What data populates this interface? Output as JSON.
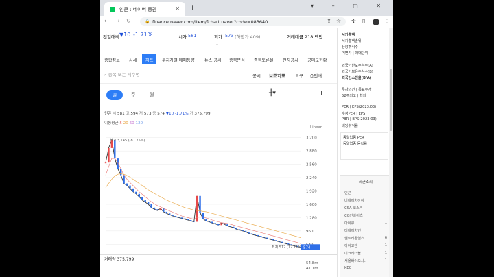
{
  "browser": {
    "tab_title": "인콘 : 네이버 증권",
    "url": "finance.naver.com/item/fchart.naver?code=083640"
  },
  "ticker": {
    "prev_label": "전일대비",
    "change": "▼10",
    "change_pct": "-1.71%",
    "open_label": "시가",
    "open": "581",
    "low_label": "저가",
    "low": "573",
    "low_limit": "(하한가 409)",
    "value_label": "거래대금",
    "value": "218 백만"
  },
  "tabs": [
    "종합정보",
    "시세",
    "차트",
    "투자자별 매매동향",
    "뉴스 공시",
    "종목분석",
    "종목토론실",
    "전자공시",
    "공매도현황"
  ],
  "active_tab": "차트",
  "search": {
    "placeholder": "종목 또는 지수명"
  },
  "tools": {
    "notice": "공시",
    "indicators": "보조지표",
    "tools": "도구",
    "print": "인쇄"
  },
  "periods": [
    "일",
    "주",
    "월"
  ],
  "ohlc": {
    "name": "인콘",
    "open_label": "시",
    "open": "581",
    "high_label": "고",
    "high": "594",
    "low_label": "저",
    "low": "573",
    "close_label": "종",
    "close": "574",
    "change": "▼10 -1.71%",
    "vol_label": "거",
    "volume": "375,799"
  },
  "ma": {
    "label": "이동평균",
    "values": [
      "5",
      "20",
      "60",
      "120"
    ]
  },
  "chart_data": {
    "type": "line",
    "scale": "Linear",
    "y_ticks": [
      "3,200",
      "2,880",
      "2,560",
      "2,240",
      "1,920",
      "1,600",
      "1,280",
      "960",
      "640"
    ],
    "ylim": [
      480,
      3360
    ],
    "max_label": "최고 3,145 (-81.75%)",
    "min_label": "최저 512 (12.11%)",
    "last_price": "574",
    "series": [
      {
        "values": [
          2600,
          2950,
          3145,
          2700,
          2450,
          2300,
          2100,
          2050,
          1980,
          1900,
          1850,
          1780,
          1700,
          1650,
          1600,
          1520,
          1480,
          1450,
          1500,
          1420,
          1380,
          1350,
          1320,
          1300,
          1280,
          1260,
          1240,
          1220,
          1200,
          1180,
          1800,
          1400,
          1250,
          1200,
          1180,
          1150,
          1130,
          1100,
          1150,
          1120,
          1080,
          1060,
          1040,
          1000,
          980,
          960,
          940,
          900,
          880,
          860,
          840,
          820,
          800,
          780,
          760,
          740,
          720,
          700,
          680,
          660,
          640,
          620,
          600,
          580,
          574
        ]
      },
      {
        "values": [
          2300,
          2500,
          2700,
          2700,
          2600,
          2450,
          2300,
          2200,
          2120,
          2050,
          1980,
          1900,
          1840,
          1780,
          1720,
          1660,
          1610,
          1570,
          1540,
          1500,
          1470,
          1440,
          1410,
          1380,
          1350,
          1320,
          1300,
          1280,
          1260,
          1240,
          1280,
          1300,
          1290,
          1270,
          1250,
          1220,
          1200,
          1180,
          1160,
          1150,
          1140,
          1120,
          1100,
          1080,
          1060,
          1040,
          1020,
          1000,
          980,
          960,
          940,
          920,
          900,
          880,
          860,
          840,
          820,
          800,
          780,
          760,
          740,
          720,
          700,
          680,
          660
        ]
      },
      {
        "values": [
          2000,
          2100,
          2200,
          2280,
          2320,
          2330,
          2320,
          2290,
          2250,
          2200,
          2150,
          2100,
          2050,
          2000,
          1950,
          1900,
          1860,
          1820,
          1780,
          1740,
          1700,
          1670,
          1640,
          1610,
          1580,
          1550,
          1520,
          1500,
          1480,
          1460,
          1450,
          1440,
          1430,
          1420,
          1400,
          1380,
          1360,
          1340,
          1320,
          1300,
          1280,
          1260,
          1240,
          1220,
          1200,
          1180,
          1160,
          1140,
          1120,
          1100,
          1080,
          1060,
          1040,
          1020,
          1000,
          980,
          960,
          940,
          920,
          900,
          880,
          860,
          840,
          820,
          800
        ]
      }
    ]
  },
  "volume": {
    "label": "거래량",
    "value": "375,799",
    "ticks": [
      "54.8m",
      "41.1m"
    ]
  },
  "sidebar": {
    "items": [
      "시가총액",
      "시가총액순위",
      "상장주식수",
      "액면가 | 매매단위",
      "외국인한도주식수(A)",
      "외국인보유주식수(B)",
      "외국인소진율(B/A)",
      "투자의견 | 목표주가",
      "52주최고 | 최저",
      "PER | EPS(2023.03)",
      "추정PER | EPS",
      "PBR | BPS(2023.03)",
      "배당수익률"
    ],
    "per_items": [
      "동일업종 PER",
      "동일업종 등락률"
    ],
    "recent_title": "최근조회",
    "recent": [
      "인콘",
      "비에이치아이",
      "CSA 코스믹",
      "CG인바이츠",
      "아이큐",
      "티에이치엔",
      "셀트리온헬스..",
      "아이코젠",
      "이크레더블",
      "서울바이오시..",
      "KEC"
    ],
    "recent_nums": [
      "",
      "",
      "",
      "",
      "1",
      "",
      "6",
      "1",
      "1",
      "1",
      ""
    ]
  }
}
